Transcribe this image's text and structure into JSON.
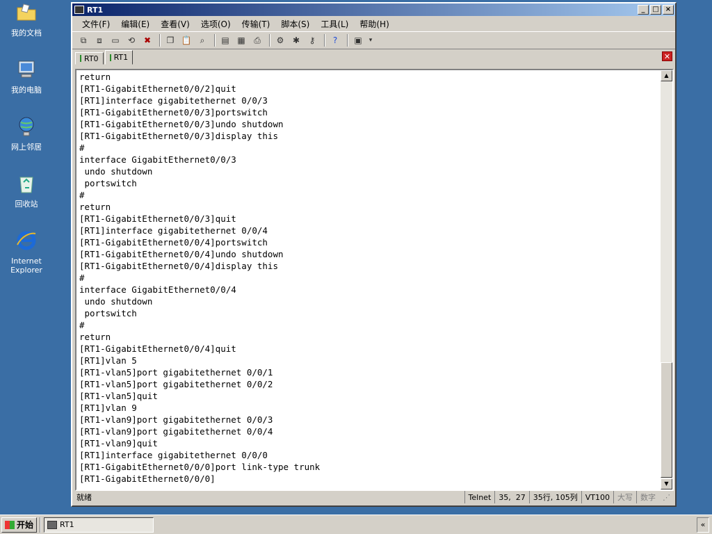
{
  "desktop": {
    "icons": [
      {
        "label": "我的文档",
        "icon": "folder-icon"
      },
      {
        "label": "我的电脑",
        "icon": "computer-icon"
      },
      {
        "label": "网上邻居",
        "icon": "network-icon"
      },
      {
        "label": "回收站",
        "icon": "recycle-bin-icon"
      },
      {
        "label": "Internet Explorer",
        "icon": "ie-icon"
      }
    ]
  },
  "window": {
    "title": "RT1",
    "menu": [
      "文件(F)",
      "编辑(E)",
      "查看(V)",
      "选项(O)",
      "传输(T)",
      "脚本(S)",
      "工具(L)",
      "帮助(H)"
    ],
    "tabs": [
      {
        "label": "RT0",
        "active": false
      },
      {
        "label": "RT1",
        "active": true
      }
    ],
    "terminal_lines": [
      "return",
      "[RT1-GigabitEthernet0/0/2]quit",
      "[RT1]interface gigabitethernet 0/0/3",
      "[RT1-GigabitEthernet0/0/3]portswitch",
      "[RT1-GigabitEthernet0/0/3]undo shutdown",
      "[RT1-GigabitEthernet0/0/3]display this",
      "#",
      "interface GigabitEthernet0/0/3",
      " undo shutdown",
      " portswitch",
      "#",
      "return",
      "[RT1-GigabitEthernet0/0/3]quit",
      "[RT1]interface gigabitethernet 0/0/4",
      "[RT1-GigabitEthernet0/0/4]portswitch",
      "[RT1-GigabitEthernet0/0/4]undo shutdown",
      "[RT1-GigabitEthernet0/0/4]display this",
      "#",
      "interface GigabitEthernet0/0/4",
      " undo shutdown",
      " portswitch",
      "#",
      "return",
      "[RT1-GigabitEthernet0/0/4]quit",
      "[RT1]vlan 5",
      "[RT1-vlan5]port gigabitethernet 0/0/1",
      "[RT1-vlan5]port gigabitethernet 0/0/2",
      "[RT1-vlan5]quit",
      "[RT1]vlan 9",
      "[RT1-vlan9]port gigabitethernet 0/0/3",
      "[RT1-vlan9]port gigabitethernet 0/0/4",
      "[RT1-vlan9]quit",
      "[RT1]interface gigabitethernet 0/0/0",
      "[RT1-GigabitEthernet0/0/0]port link-type trunk",
      "[RT1-GigabitEthernet0/0/0]"
    ],
    "status": {
      "ready": "就绪",
      "protocol": "Telnet",
      "cursor": "35,  27",
      "size": "35行, 105列",
      "emulation": "VT100",
      "caps": "大写",
      "num": "数字"
    }
  },
  "taskbar": {
    "start_label": "开始",
    "task_label": "RT1",
    "tray_label": "«"
  }
}
